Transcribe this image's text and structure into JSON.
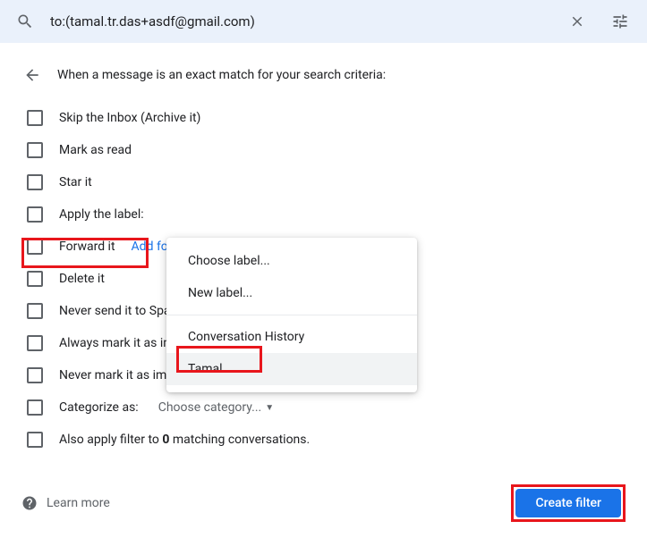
{
  "search": {
    "value": "to:(tamal.tr.das+asdf@gmail.com)"
  },
  "heading": "When a message is an exact match for your search criteria:",
  "options": {
    "skip_inbox": "Skip the Inbox (Archive it)",
    "mark_read": "Mark as read",
    "star": "Star it",
    "apply_label": "Apply the label:",
    "forward": "Forward it",
    "forward_link": "Add forwarding address",
    "delete": "Delete it",
    "never_spam": "Never send it to Spam",
    "always_important": "Always mark it as important",
    "never_important": "Never mark it as important",
    "categorize": "Categorize as:",
    "categorize_value": "Choose category...",
    "also_apply_prefix": "Also apply filter to ",
    "also_apply_count": "0",
    "also_apply_suffix": " matching conversations."
  },
  "dropdown": {
    "choose_label": "Choose label...",
    "new_label": "New label...",
    "conversation_history": "Conversation History",
    "tamal": "Tamal"
  },
  "footer": {
    "learn_more": "Learn more",
    "create_filter": "Create filter"
  }
}
